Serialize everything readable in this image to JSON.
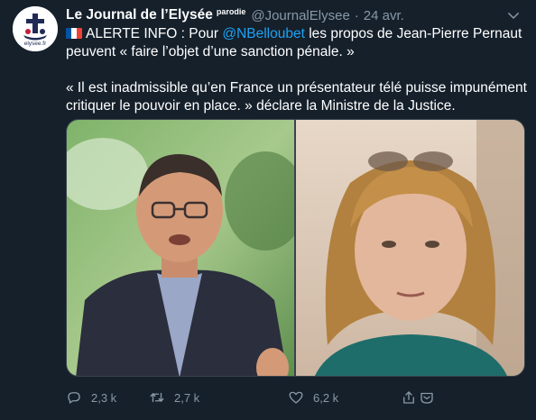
{
  "tweet": {
    "author": {
      "display_name": "Le Journal de l’Elysée",
      "parody_badge": "parodie",
      "handle": "@JournalElysee",
      "avatar_caption": "elysee.fr"
    },
    "separator": "·",
    "date": "24 avr.",
    "text": {
      "line1_flag": "france-flag-icon",
      "line1_prefix": "ALERTE INFO : Pour ",
      "line1_mention": "@NBelloubet",
      "line1_suffix": " les propos de Jean-Pierre Pernaut peuvent « faire l’objet d’une sanction pénale. »",
      "line2": "« Il est inadmissible qu’en France un présentateur télé puisse impunément critiquer le pouvoir en place. » déclare la Ministre de la Justice."
    },
    "media": [
      {
        "kind": "photo",
        "subject": "man-in-suit-photo"
      },
      {
        "kind": "photo",
        "subject": "woman-with-glasses-photo"
      }
    ],
    "actions": {
      "replies": "2,3 k",
      "retweets": "2,7 k",
      "likes": "6,2 k"
    }
  },
  "colors": {
    "background": "#15202b",
    "text": "#ffffff",
    "muted": "#8899a6",
    "link": "#1da1f2",
    "border": "#38444d"
  },
  "icons": [
    "chevron-down-icon",
    "reply-icon",
    "retweet-icon",
    "like-icon",
    "share-icon",
    "france-flag-icon"
  ]
}
